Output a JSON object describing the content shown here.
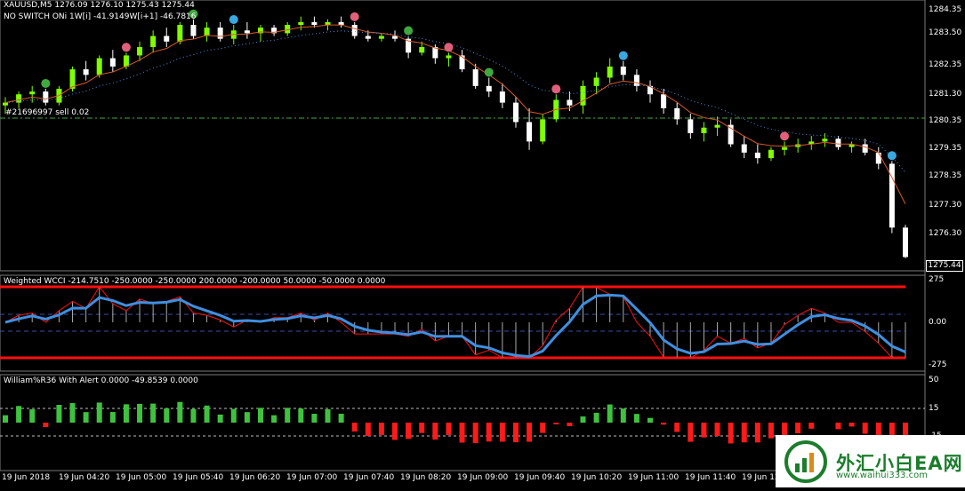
{
  "symbol_header": "XAUUSD,M5  1276.09 1276.10 1275.43 1275.44",
  "indicator_line": "NO SWITCH ONi 1W[i] -41.9149W[i+1] -46.7816",
  "order_label": "#21696997 sell 0.02",
  "current_price": "1275.44",
  "price_axis": [
    "1284.35",
    "1283.50",
    "1282.35",
    "1281.30",
    "1280.35",
    "1279.35",
    "1278.35",
    "1277.30",
    "1276.30"
  ],
  "wcci": {
    "title": "Weighted WCCI -214.7510 -250.0000 -250.0000 200.0000 -200.0000 50.0000 -50.0000 0.0000",
    "axis": [
      "275",
      "0.00",
      "-275"
    ]
  },
  "williams": {
    "title": "William%R36 With Alert 0.0000 -49.8539 0.0000",
    "axis": [
      "50",
      "15",
      "-15"
    ]
  },
  "time_axis": [
    "19 Jun 2018",
    "19 Jun 04:20",
    "19 Jun 05:00",
    "19 Jun 05:40",
    "19 Jun 06:20",
    "19 Jun 07:00",
    "19 Jun 07:40",
    "19 Jun 08:20",
    "19 Jun 09:00",
    "19 Jun 09:40",
    "19 Jun 10:20",
    "19 Jun 11:00",
    "19 Jun 11:40",
    "19 Jun 12"
  ],
  "colors": {
    "bull": "#7fff00",
    "bear": "#ffffff",
    "wcci_line": "#3f8fe0",
    "wcci_signal": "#ff1010",
    "level": "#ff1010",
    "hist_up": "#3fc23f",
    "hist_down": "#ff1a1a",
    "grid": "#2a6a2a"
  },
  "watermark": {
    "name": "外汇小白EA网",
    "url": "www.waihui333.com"
  },
  "chart_data": {
    "type": "candlestick",
    "candles": [
      [
        1280.9,
        1281.2,
        1280.6,
        1281.0
      ],
      [
        1281.0,
        1281.4,
        1280.8,
        1281.3
      ],
      [
        1281.3,
        1281.6,
        1281.0,
        1281.4
      ],
      [
        1281.4,
        1281.5,
        1280.9,
        1281.0
      ],
      [
        1281.0,
        1281.6,
        1280.9,
        1281.5
      ],
      [
        1281.5,
        1282.3,
        1281.4,
        1282.2
      ],
      [
        1282.2,
        1282.5,
        1281.8,
        1282.0
      ],
      [
        1282.0,
        1282.7,
        1281.9,
        1282.6
      ],
      [
        1282.6,
        1282.9,
        1282.1,
        1282.3
      ],
      [
        1282.3,
        1282.8,
        1282.2,
        1282.7
      ],
      [
        1282.7,
        1283.2,
        1282.5,
        1283.0
      ],
      [
        1283.0,
        1283.6,
        1282.8,
        1283.4
      ],
      [
        1283.4,
        1283.7,
        1283.0,
        1283.2
      ],
      [
        1283.2,
        1283.9,
        1283.1,
        1283.8
      ],
      [
        1283.8,
        1284.0,
        1283.3,
        1283.4
      ],
      [
        1283.4,
        1283.9,
        1283.2,
        1283.7
      ],
      [
        1283.7,
        1283.9,
        1283.2,
        1283.3
      ],
      [
        1283.3,
        1283.8,
        1283.1,
        1283.6
      ],
      [
        1283.6,
        1283.9,
        1283.3,
        1283.5
      ],
      [
        1283.5,
        1283.8,
        1283.2,
        1283.7
      ],
      [
        1283.7,
        1283.8,
        1283.4,
        1283.5
      ],
      [
        1283.5,
        1283.9,
        1283.4,
        1283.8
      ],
      [
        1283.8,
        1284.1,
        1283.6,
        1283.9
      ],
      [
        1283.9,
        1284.1,
        1283.7,
        1283.8
      ],
      [
        1283.8,
        1284.0,
        1283.6,
        1283.9
      ],
      [
        1283.9,
        1284.1,
        1283.7,
        1283.8
      ],
      [
        1283.8,
        1283.9,
        1283.3,
        1283.4
      ],
      [
        1283.4,
        1283.6,
        1283.2,
        1283.3
      ],
      [
        1283.3,
        1283.5,
        1283.2,
        1283.4
      ],
      [
        1283.4,
        1283.6,
        1283.2,
        1283.3
      ],
      [
        1283.3,
        1283.4,
        1282.6,
        1282.8
      ],
      [
        1282.8,
        1283.2,
        1282.7,
        1283.0
      ],
      [
        1283.0,
        1283.1,
        1282.4,
        1282.6
      ],
      [
        1282.6,
        1282.8,
        1282.3,
        1282.7
      ],
      [
        1282.7,
        1282.9,
        1282.1,
        1282.2
      ],
      [
        1282.2,
        1282.4,
        1281.5,
        1281.6
      ],
      [
        1281.6,
        1281.9,
        1281.2,
        1281.4
      ],
      [
        1281.4,
        1281.7,
        1280.8,
        1281.0
      ],
      [
        1281.0,
        1281.2,
        1280.1,
        1280.3
      ],
      [
        1280.3,
        1280.8,
        1279.3,
        1279.6
      ],
      [
        1279.6,
        1280.6,
        1279.5,
        1280.4
      ],
      [
        1280.4,
        1281.3,
        1280.3,
        1281.1
      ],
      [
        1281.1,
        1281.4,
        1280.7,
        1280.9
      ],
      [
        1280.9,
        1281.8,
        1280.6,
        1281.6
      ],
      [
        1281.6,
        1282.1,
        1281.3,
        1281.9
      ],
      [
        1281.9,
        1282.6,
        1281.7,
        1282.3
      ],
      [
        1282.3,
        1282.5,
        1281.8,
        1282.0
      ],
      [
        1282.0,
        1282.2,
        1281.4,
        1281.6
      ],
      [
        1281.6,
        1281.8,
        1281.0,
        1281.3
      ],
      [
        1281.3,
        1281.5,
        1280.6,
        1280.8
      ],
      [
        1280.8,
        1281.0,
        1280.2,
        1280.4
      ],
      [
        1280.4,
        1280.6,
        1279.7,
        1279.9
      ],
      [
        1279.9,
        1280.3,
        1279.6,
        1280.1
      ],
      [
        1280.1,
        1280.5,
        1279.8,
        1280.2
      ],
      [
        1280.2,
        1280.4,
        1279.4,
        1279.5
      ],
      [
        1279.5,
        1279.8,
        1279.0,
        1279.2
      ],
      [
        1279.2,
        1279.5,
        1278.8,
        1279.0
      ],
      [
        1279.0,
        1279.4,
        1278.9,
        1279.3
      ],
      [
        1279.3,
        1279.6,
        1279.1,
        1279.4
      ],
      [
        1279.4,
        1279.7,
        1279.2,
        1279.5
      ],
      [
        1279.5,
        1279.8,
        1279.3,
        1279.6
      ],
      [
        1279.6,
        1279.9,
        1279.4,
        1279.7
      ],
      [
        1279.7,
        1279.8,
        1279.3,
        1279.4
      ],
      [
        1279.4,
        1279.6,
        1279.2,
        1279.5
      ],
      [
        1279.5,
        1279.7,
        1279.1,
        1279.2
      ],
      [
        1279.2,
        1279.4,
        1278.6,
        1278.8
      ],
      [
        1278.8,
        1278.9,
        1276.3,
        1276.5
      ],
      [
        1276.5,
        1276.6,
        1275.4,
        1275.44
      ]
    ]
  }
}
